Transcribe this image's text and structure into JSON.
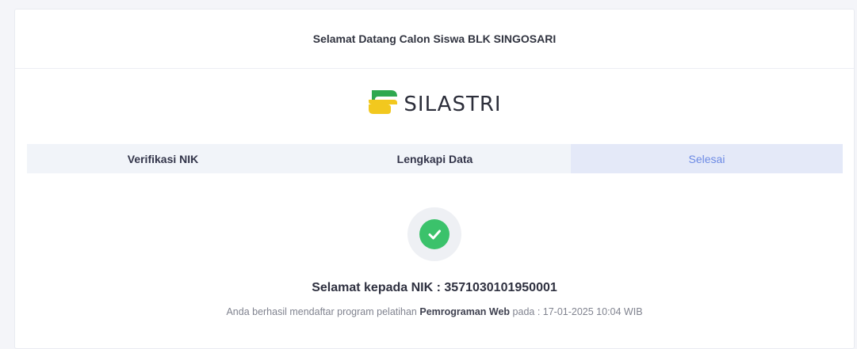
{
  "header": {
    "title": "Selamat Datang Calon Siswa BLK SINGOSARI"
  },
  "logo": {
    "text": "SILASTRI",
    "icon": "silastri-logo-icon",
    "colors": {
      "green": "#2fa84f",
      "yellow": "#f2c81e"
    }
  },
  "steps": [
    {
      "label": "Verifikasi NIK",
      "active": false
    },
    {
      "label": "Lengkapi Data",
      "active": false
    },
    {
      "label": "Selesai",
      "active": true
    }
  ],
  "result": {
    "icon": "check-icon",
    "title": "Selamat kepada NIK : 3571030101950001",
    "sub_prefix": "Anda berhasil mendaftar program pelatihan ",
    "program": "Pemrograman Web",
    "sub_suffix": " pada : 17-01-2025 10:04 WIB"
  },
  "colors": {
    "accent": "#6c8ae4",
    "success": "#3bc26b"
  }
}
